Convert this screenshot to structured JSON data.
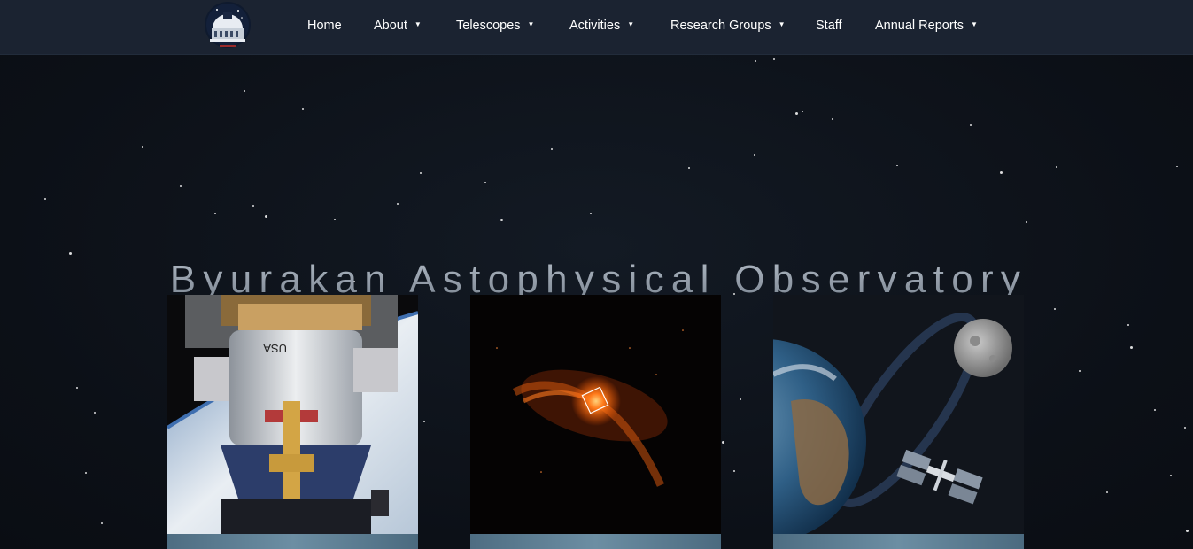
{
  "nav": {
    "logo_alt": "Byurakan observatory logo",
    "items": [
      {
        "label": "Home",
        "dropdown": false
      },
      {
        "label": "About",
        "dropdown": true
      },
      {
        "label": "Telescopes",
        "dropdown": true
      },
      {
        "label": "Activities",
        "dropdown": true
      },
      {
        "label": "Research Groups",
        "dropdown": true
      },
      {
        "label": "Staff",
        "dropdown": false
      },
      {
        "label": "Annual Reports",
        "dropdown": true
      }
    ],
    "caret": "▼"
  },
  "hero": {
    "title": "Byurakan Astophysical Observatory"
  },
  "cards": [
    {
      "image": "space-station-module-photo"
    },
    {
      "image": "galaxy-black-hole-image"
    },
    {
      "image": "earth-moon-satellite-illustration"
    }
  ],
  "colors": {
    "navbar_bg": "#1b2331",
    "page_bg": "#0c1017",
    "title_gradient_top": "#b0b9c4",
    "title_gradient_bottom": "#7b8591"
  }
}
